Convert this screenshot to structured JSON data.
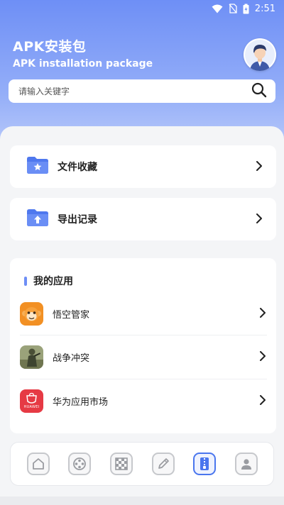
{
  "status_bar": {
    "time": "2:51"
  },
  "header": {
    "title": "APK安装包",
    "subtitle": "APK installation package"
  },
  "search": {
    "placeholder": "请输入关键字"
  },
  "menu": [
    {
      "label": "文件收藏",
      "icon": "folder-star-icon"
    },
    {
      "label": "导出记录",
      "icon": "folder-upload-icon"
    }
  ],
  "my_apps": {
    "title": "我的应用",
    "items": [
      {
        "label": "悟空管家",
        "icon": "monkey-app-icon"
      },
      {
        "label": "战争冲突",
        "icon": "soldier-app-icon"
      },
      {
        "label": "华为应用市场",
        "icon": "huawei-appgallery-icon",
        "icon_text": "HUAWEI"
      }
    ]
  },
  "nav": {
    "items": [
      "home-icon",
      "film-reel-icon",
      "checker-icon",
      "pencil-icon",
      "zip-archive-icon",
      "user-icon"
    ],
    "active_index": 4
  },
  "colors": {
    "accent": "#6d8ef6",
    "active": "#4a76ee",
    "huawei_red": "#e63a44"
  }
}
